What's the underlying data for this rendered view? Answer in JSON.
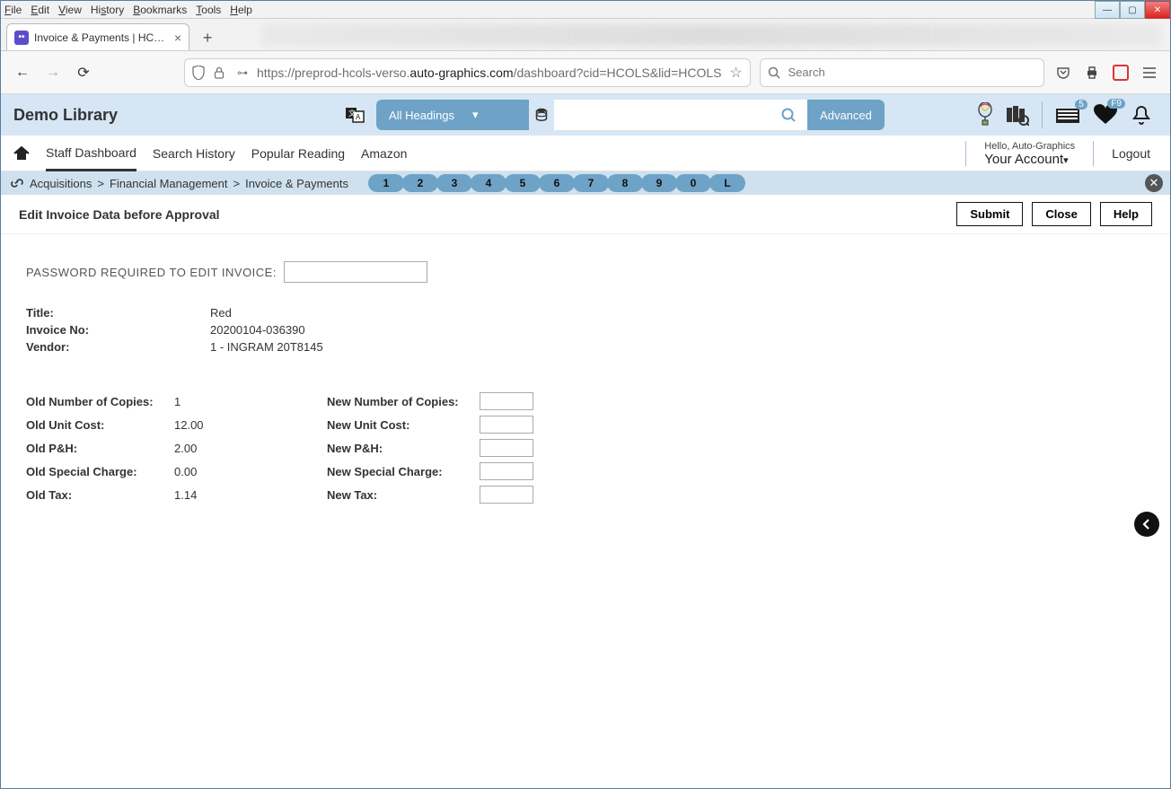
{
  "os": {
    "menus": [
      "File",
      "Edit",
      "View",
      "History",
      "Bookmarks",
      "Tools",
      "Help"
    ]
  },
  "browser": {
    "tab_title": "Invoice & Payments | HCOLS | H",
    "url_prefix": "https://preprod-hcols-verso.",
    "url_bold": "auto-graphics.com",
    "url_suffix": "/dashboard?cid=HCOLS&lid=HCOLS",
    "search_placeholder": "Search"
  },
  "app": {
    "library_name": "Demo Library",
    "headings_label": "All Headings",
    "advanced_label": "Advanced",
    "inbox_badge": "5",
    "heart_badge": "F9",
    "nav": {
      "staff_dashboard": "Staff Dashboard",
      "search_history": "Search History",
      "popular_reading": "Popular Reading",
      "amazon": "Amazon"
    },
    "account": {
      "hello": "Hello, Auto-Graphics",
      "your_account": "Your Account",
      "logout": "Logout"
    },
    "breadcrumb": {
      "a": "Acquisitions",
      "b": "Financial Management",
      "c": "Invoice & Payments"
    },
    "pills": [
      "1",
      "2",
      "3",
      "4",
      "5",
      "6",
      "7",
      "8",
      "9",
      "0",
      "L"
    ],
    "page_title": "Edit Invoice Data before Approval",
    "buttons": {
      "submit": "Submit",
      "close": "Close",
      "help": "Help"
    },
    "password_label": "PASSWORD REQUIRED TO EDIT INVOICE:",
    "meta": {
      "title_label": "Title:",
      "title_value": "Red",
      "invoice_label": "Invoice No:",
      "invoice_value": "20200104-036390",
      "vendor_label": "Vendor:",
      "vendor_value": "1 - INGRAM 20T8145"
    },
    "old": {
      "copies_label": "Old Number of Copies:",
      "copies_value": "1",
      "unit_label": "Old Unit Cost:",
      "unit_value": "12.00",
      "pnh_label": "Old P&H:",
      "pnh_value": "2.00",
      "special_label": "Old Special Charge:",
      "special_value": "0.00",
      "tax_label": "Old Tax:",
      "tax_value": "1.14"
    },
    "new": {
      "copies_label": "New Number of Copies:",
      "unit_label": "New Unit Cost:",
      "pnh_label": "New P&H:",
      "special_label": "New Special Charge:",
      "tax_label": "New Tax:"
    }
  }
}
